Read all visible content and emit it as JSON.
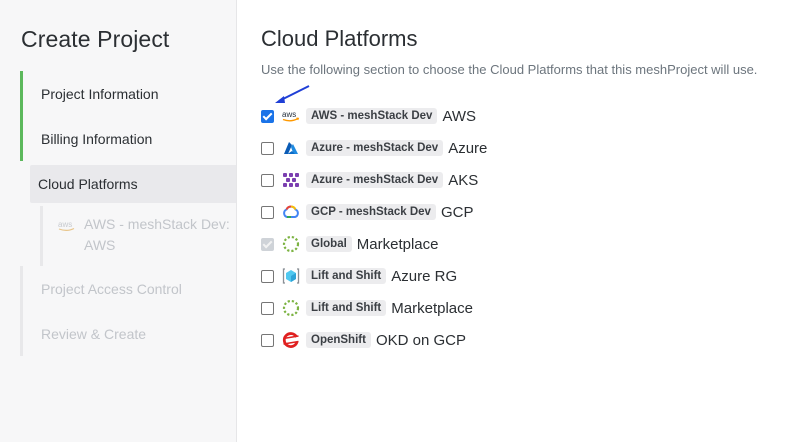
{
  "sidebar": {
    "title": "Create Project",
    "steps": [
      {
        "label": "Project Information"
      },
      {
        "label": "Billing Information"
      },
      {
        "label": "Cloud Platforms"
      },
      {
        "label": "Project Access Control"
      },
      {
        "label": "Review & Create"
      }
    ],
    "substep": {
      "icon_text": "aws",
      "label": "AWS - meshStack Dev: AWS"
    }
  },
  "main": {
    "title": "Cloud Platforms",
    "description": "Use the following section to choose the Cloud Platforms that this meshProject will use.",
    "platforms": [
      {
        "badge": "AWS - meshStack Dev",
        "name": "AWS",
        "checked": true,
        "disabled": false,
        "icon": "aws-icon",
        "icon_text": "aws"
      },
      {
        "badge": "Azure - meshStack Dev",
        "name": "Azure",
        "checked": false,
        "disabled": false,
        "icon": "azure-icon"
      },
      {
        "badge": "Azure - meshStack Dev",
        "name": "AKS",
        "checked": false,
        "disabled": false,
        "icon": "aks-icon"
      },
      {
        "badge": "GCP - meshStack Dev",
        "name": "GCP",
        "checked": false,
        "disabled": false,
        "icon": "gcp-icon"
      },
      {
        "badge": "Global",
        "name": "Marketplace",
        "checked": true,
        "disabled": true,
        "icon": "marketplace-icon"
      },
      {
        "badge": "Lift and Shift",
        "name": "Azure RG",
        "checked": false,
        "disabled": false,
        "icon": "azure-rg-icon"
      },
      {
        "badge": "Lift and Shift",
        "name": "Marketplace",
        "checked": false,
        "disabled": false,
        "icon": "marketplace-icon"
      },
      {
        "badge": "OpenShift",
        "name": "OKD on GCP",
        "checked": false,
        "disabled": false,
        "icon": "openshift-icon"
      }
    ]
  },
  "colors": {
    "accent": "#1a73e8",
    "done": "#5cb85c",
    "annotation_arrow": "#1f3fd6"
  }
}
